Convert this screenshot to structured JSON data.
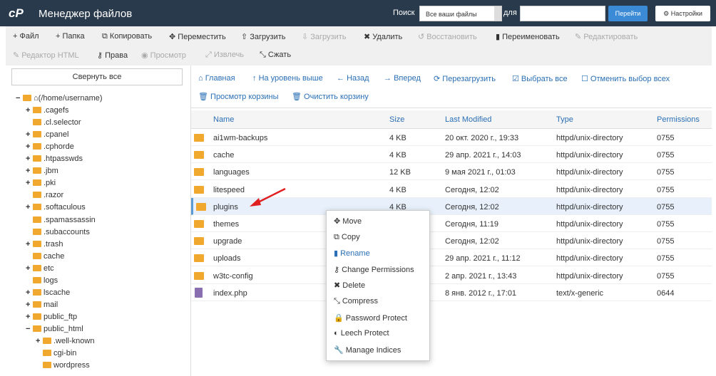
{
  "header": {
    "logo": "cP",
    "title": "Менеджер файлов",
    "search_label": "Поиск",
    "search_scope": "Все ваши файлы",
    "for_label": "для",
    "search_value": "",
    "go": "Перейти",
    "settings": "Настройки"
  },
  "toolbar": [
    {
      "label": "Файл",
      "icon": "+",
      "enabled": true
    },
    {
      "label": "Папка",
      "icon": "+",
      "enabled": true
    },
    {
      "label": "Копировать",
      "icon": "⧉",
      "enabled": true
    },
    {
      "label": "Переместить",
      "icon": "✥",
      "enabled": true
    },
    {
      "label": "Загрузить",
      "icon": "⇧",
      "enabled": true
    },
    {
      "label": "Загрузить",
      "icon": "⇩",
      "enabled": false
    },
    {
      "label": "Удалить",
      "icon": "✖",
      "enabled": true
    },
    {
      "label": "Восстановить",
      "icon": "↺",
      "enabled": false
    },
    {
      "label": "Переименовать",
      "icon": "▮",
      "enabled": true
    },
    {
      "label": "Редактировать",
      "icon": "✎",
      "enabled": false
    },
    {
      "label": "Редактор HTML",
      "icon": "✎",
      "enabled": false
    },
    {
      "label": "Права",
      "icon": "⚷",
      "enabled": true
    },
    {
      "label": "Просмотр",
      "icon": "◉",
      "enabled": false
    },
    {
      "label": "Извлечь",
      "icon": "⤢",
      "enabled": false
    },
    {
      "label": "Сжать",
      "icon": "⤡",
      "enabled": true
    }
  ],
  "sidebar": {
    "collapse_all": "Свернуть все",
    "tree": [
      {
        "label": "(/home/username)",
        "depth": 0,
        "toggle": "−",
        "home": true
      },
      {
        "label": ".cagefs",
        "depth": 1,
        "toggle": "+"
      },
      {
        "label": ".cl.selector",
        "depth": 1,
        "toggle": ""
      },
      {
        "label": ".cpanel",
        "depth": 1,
        "toggle": "+"
      },
      {
        "label": ".cphorde",
        "depth": 1,
        "toggle": "+"
      },
      {
        "label": ".htpasswds",
        "depth": 1,
        "toggle": "+"
      },
      {
        "label": ".jbm",
        "depth": 1,
        "toggle": "+"
      },
      {
        "label": ".pki",
        "depth": 1,
        "toggle": "+"
      },
      {
        "label": ".razor",
        "depth": 1,
        "toggle": ""
      },
      {
        "label": ".softaculous",
        "depth": 1,
        "toggle": "+"
      },
      {
        "label": ".spamassassin",
        "depth": 1,
        "toggle": ""
      },
      {
        "label": ".subaccounts",
        "depth": 1,
        "toggle": ""
      },
      {
        "label": ".trash",
        "depth": 1,
        "toggle": "+"
      },
      {
        "label": "cache",
        "depth": 1,
        "toggle": ""
      },
      {
        "label": "etc",
        "depth": 1,
        "toggle": "+"
      },
      {
        "label": "logs",
        "depth": 1,
        "toggle": ""
      },
      {
        "label": "lscache",
        "depth": 1,
        "toggle": "+"
      },
      {
        "label": "mail",
        "depth": 1,
        "toggle": "+"
      },
      {
        "label": "public_ftp",
        "depth": 1,
        "toggle": "+"
      },
      {
        "label": "public_html",
        "depth": 1,
        "toggle": "−"
      },
      {
        "label": ".well-known",
        "depth": 2,
        "toggle": "+"
      },
      {
        "label": "cgi-bin",
        "depth": 2,
        "toggle": ""
      },
      {
        "label": "wordpress",
        "depth": 2,
        "toggle": ""
      }
    ]
  },
  "nav": [
    {
      "label": "Главная",
      "icon": "⌂",
      "enabled": true
    },
    {
      "label": "На уровень выше",
      "icon": "↑",
      "enabled": true
    },
    {
      "label": "Назад",
      "icon": "←",
      "enabled": true
    },
    {
      "label": "Вперед",
      "icon": "→",
      "enabled": false
    },
    {
      "label": "Перезагрузить",
      "icon": "⟳",
      "enabled": true
    },
    {
      "label": "Выбрать все",
      "icon": "☑",
      "enabled": true
    },
    {
      "label": "Отменить выбор всех",
      "icon": "☐",
      "enabled": true
    },
    {
      "label": "Просмотр корзины",
      "icon": "🗑",
      "enabled": true
    },
    {
      "label": "Очистить корзину",
      "icon": "🗑",
      "enabled": false
    }
  ],
  "table": {
    "columns": [
      "Name",
      "Size",
      "Last Modified",
      "Type",
      "Permissions"
    ],
    "rows": [
      [
        "ai1wm-backups",
        "4 KB",
        "20 окт. 2020 г., 19:33",
        "httpd/unix-directory",
        "0755"
      ],
      [
        "cache",
        "4 KB",
        "29 апр. 2021 г., 14:03",
        "httpd/unix-directory",
        "0755"
      ],
      [
        "languages",
        "12 KB",
        "9 мая 2021 г., 01:03",
        "httpd/unix-directory",
        "0755"
      ],
      [
        "litespeed",
        "4 KB",
        "Сегодня, 12:02",
        "httpd/unix-directory",
        "0755"
      ],
      [
        "plugins",
        "4 KB",
        "Сегодня, 12:02",
        "httpd/unix-directory",
        "0755"
      ],
      [
        "themes",
        "4 KB",
        "Сегодня, 11:19",
        "httpd/unix-directory",
        "0755"
      ],
      [
        "upgrade",
        "4 KB",
        "Сегодня, 12:02",
        "httpd/unix-directory",
        "0755"
      ],
      [
        "uploads",
        "4 KB",
        "29 апр. 2021 г., 11:12",
        "httpd/unix-directory",
        "0755"
      ],
      [
        "w3tc-config",
        "4 KB",
        "2 апр. 2021 г., 13:43",
        "httpd/unix-directory",
        "0755"
      ],
      [
        "index.php",
        "418 bytes",
        "8 янв. 2012 г., 17:01",
        "text/x-generic",
        "0644"
      ]
    ],
    "selected": "plugins"
  },
  "context_menu": [
    {
      "label": "Move",
      "icon": "✥"
    },
    {
      "label": "Copy",
      "icon": "⧉"
    },
    {
      "label": "Rename",
      "icon": "▮",
      "active": true
    },
    {
      "label": "Change Permissions",
      "icon": "⚷"
    },
    {
      "label": "Delete",
      "icon": "✖"
    },
    {
      "label": "Compress",
      "icon": "⤡"
    },
    {
      "label": "Password Protect",
      "icon": "🔒"
    },
    {
      "label": "Leech Protect",
      "icon": "◐"
    },
    {
      "label": "Manage Indices",
      "icon": "🔧"
    }
  ],
  "colors": {
    "header": "#293a4c",
    "accent": "#2a6fb5",
    "folder": "#f0a92e",
    "arrow": "#e02020"
  }
}
